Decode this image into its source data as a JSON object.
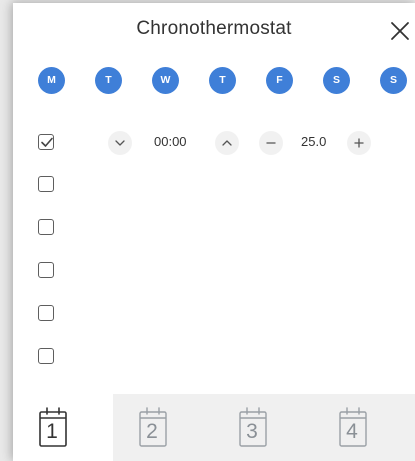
{
  "window": {
    "title": "Chronothermostat"
  },
  "days": [
    "M",
    "T",
    "W",
    "T",
    "F",
    "S",
    "S"
  ],
  "schedule": {
    "time": "00:00",
    "temperature": "25.0"
  },
  "rows": [
    {
      "checked": true
    },
    {
      "checked": false
    },
    {
      "checked": false
    },
    {
      "checked": false
    },
    {
      "checked": false
    },
    {
      "checked": false
    }
  ],
  "tabs": [
    {
      "label": "1",
      "active": true
    },
    {
      "label": "2",
      "active": false
    },
    {
      "label": "3",
      "active": false
    },
    {
      "label": "4",
      "active": false
    }
  ],
  "colors": {
    "day_badge": "#3f7fd8",
    "tab_active_icon": "#333333",
    "tab_inactive_icon": "#9aa0a6",
    "tabbar_bg": "#f0f0f0"
  },
  "icons": {
    "close": "close-icon",
    "check": "checkmark-icon",
    "chevron_down": "chevron-down-icon",
    "chevron_up": "chevron-up-icon",
    "minus": "minus-icon",
    "plus": "plus-icon",
    "calendar": "calendar-icon"
  }
}
